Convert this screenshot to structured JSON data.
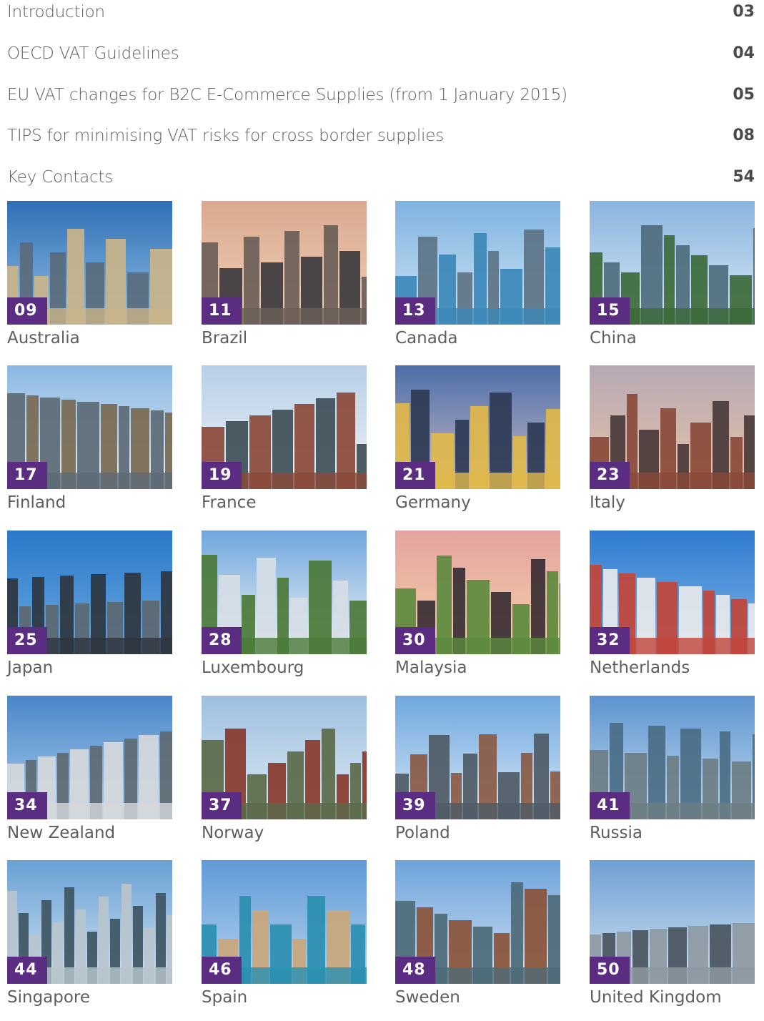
{
  "toc": [
    {
      "title": "Introduction",
      "page": "03"
    },
    {
      "title": "OECD VAT Guidelines",
      "page": "04"
    },
    {
      "title": "EU VAT changes for B2C E-Commerce Supplies (from 1 January 2015)",
      "page": "05"
    },
    {
      "title": "TIPS for minimising VAT risks for cross border supplies",
      "page": "08"
    },
    {
      "title": "Key Contacts",
      "page": "54"
    }
  ],
  "countries": [
    {
      "name": "Australia",
      "page": "09"
    },
    {
      "name": "Brazil",
      "page": "11"
    },
    {
      "name": "Canada",
      "page": "13"
    },
    {
      "name": "China",
      "page": "15"
    },
    {
      "name": "Finland",
      "page": "17"
    },
    {
      "name": "France",
      "page": "19"
    },
    {
      "name": "Germany",
      "page": "21"
    },
    {
      "name": "Italy",
      "page": "23"
    },
    {
      "name": "Japan",
      "page": "25"
    },
    {
      "name": "Luxembourg",
      "page": "28"
    },
    {
      "name": "Malaysia",
      "page": "30"
    },
    {
      "name": "Netherlands",
      "page": "32"
    },
    {
      "name": "New Zealand",
      "page": "34"
    },
    {
      "name": "Norway",
      "page": "37"
    },
    {
      "name": "Poland",
      "page": "39"
    },
    {
      "name": "Russia",
      "page": "41"
    },
    {
      "name": "Singapore",
      "page": "44"
    },
    {
      "name": "Spain",
      "page": "46"
    },
    {
      "name": "Sweden",
      "page": "48"
    },
    {
      "name": "United Kingdom",
      "page": "50"
    }
  ],
  "colors": {
    "badge": "#5b2d82",
    "text": "#5e5e5e"
  }
}
